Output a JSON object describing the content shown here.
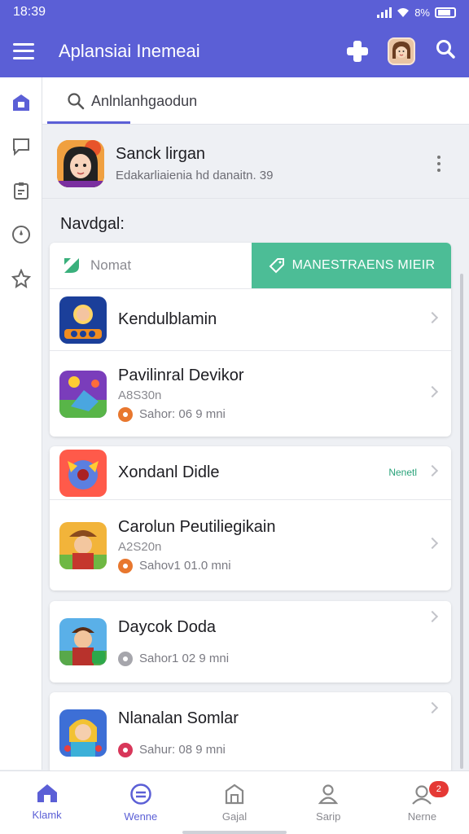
{
  "status": {
    "time": "18:39",
    "battery": "8%"
  },
  "appbar": {
    "title": "Aplansiai Inemeai"
  },
  "search": {
    "tab_label": "Anlnlanhgaodun"
  },
  "profile": {
    "name": "Sanck lirgan",
    "subtitle": "Edakarliaienia hd danaitn. 39"
  },
  "section": {
    "title": "Navdgal:"
  },
  "toggle": {
    "left_label": "Nomat",
    "right_label": "MANESTRAENS MIEIR"
  },
  "cards": [
    {
      "rows": [
        {
          "title": "Kendulblamin"
        },
        {
          "title": "Pavilinral Devikor",
          "subtitle": "A8S30n",
          "meta": "Sahor: 06 9 mni",
          "meta_color": "#e8772e"
        }
      ]
    },
    {
      "rows": [
        {
          "title": "Xondanl Didle",
          "badge": "Nenetl"
        },
        {
          "title": "Carolun Peutiliegikain",
          "subtitle": "A2S20n",
          "meta": "Sahov1 01.0 mni",
          "meta_color": "#e8772e"
        }
      ]
    },
    {
      "rows": [
        {
          "title": "Daycok Doda",
          "meta": "Sahor1 02 9 mni",
          "meta_color": "#a6a6ac"
        }
      ]
    },
    {
      "rows": [
        {
          "title": "Nlanalan Somlar",
          "meta": "Sahur: 08 9 mni",
          "meta_color": "#d8375a"
        }
      ]
    }
  ],
  "bottom_nav": {
    "items": [
      {
        "label": "Klamk"
      },
      {
        "label": "Wenne"
      },
      {
        "label": "Gajal"
      },
      {
        "label": "Sarip"
      },
      {
        "label": "Nerne",
        "badge": "2"
      }
    ]
  },
  "colors": {
    "primary": "#5b5fd6",
    "accent_green": "#4cbd96",
    "badge_red": "#e53935"
  }
}
